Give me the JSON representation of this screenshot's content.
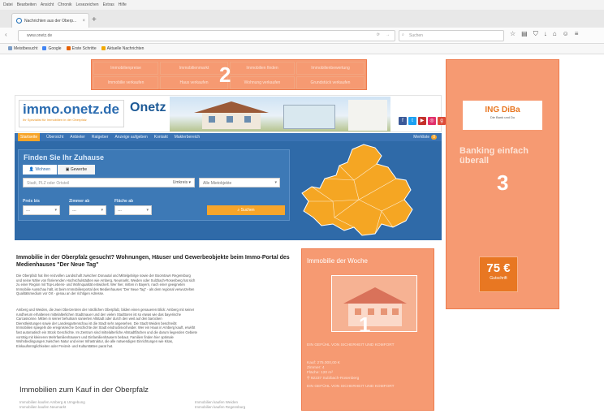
{
  "browser": {
    "menu": [
      "Datei",
      "Bearbeiten",
      "Ansicht",
      "Chronik",
      "Lesezeichen",
      "Extras",
      "Hilfe"
    ],
    "tab_title": "Nachrichten aus der Oberp...",
    "url": "www.onetz.de",
    "search_placeholder": "Suchen",
    "bookmarks": [
      "Meistbesucht",
      "Google",
      "Erste Schritte",
      "Aktuelle Nachrichten"
    ]
  },
  "top_nav": {
    "row1": [
      "Immobilienpreise",
      "Immobilienmarkt",
      "Immobilien finden",
      "Immobilienbewertung"
    ],
    "row2": [
      "Immobilie verkaufen",
      "Haus verkaufen",
      "Wohnung verkaufen",
      "Grundstück verkaufen"
    ]
  },
  "header": {
    "logo_main": "immo.onetz",
    "logo_tld": ".de",
    "logo_sub": "Ihr Spezialist für Immobilien in der Oberpfalz",
    "brand": "Onetz"
  },
  "nav": {
    "items": [
      "Startseite",
      "Übersicht",
      "Anbieter",
      "Ratgeber",
      "Anzeige aufgeben",
      "Kontakt",
      "Maklerbereich"
    ],
    "merkliste": "Merkliste",
    "merkliste_count": "0"
  },
  "search": {
    "title": "Finden Sie Ihr Zuhause",
    "tab_wohnen": "Wohnen",
    "tab_gewerbe": "Gewerbe",
    "location_placeholder": "Stadt, PLZ oder Ortsteil",
    "radius": "Umkreis",
    "category": "Alle Mietobjekte",
    "price_label": "Preis bis",
    "rooms_label": "Zimmer ab",
    "area_label": "Fläche ab",
    "empty_option": "---",
    "button": "Suchen"
  },
  "intro": {
    "title": "Immobilie in der Oberpfalz gesucht? Wohnungen, Häuser und Gewerbeobjekte beim Immo-Portal des Medienhauses \"Der Neue Tag\"",
    "p1": [
      "Die Oberpfalz hat ihre reizvollen Landschaft zwischen Donautal und Mittelgebirge sowie der Boomtown Regensburg",
      "und seine Nähe von florierenden Hochschulstädten wie Amberg, Neumarkt, Weiden oder Sulzbach-Rosenberg hat sich",
      "zu einer Region mit Top-Lebens- und Wohnqualität entwickelt. Wer hier, mitten in Bayern, nach einer geeigneten",
      "Immobilie Ausschau hält, ist beim Immobilienportal des Medienhauses \"Der Neue Tag\" - als dem regional verwurzelten",
      "Qualitätsmedium vor Ort - genau an der richtigen Adresse."
    ],
    "p2": [
      "Amberg und Weiden, die zwei Oberzentren der nördlichen Oberpfalz, bilden einen genaueren Blick: Amberg mit seiner",
      "rundherum erhaltenen mittelalterlichen Stadtmauer und den vielen Stadttoren ist so etwas wie das bayerische",
      "Carcassonne. Mitten in seiner behutsam sanierten Altstadt oder durch den weit auf den barocken",
      "Dienstleistungen sowie der Landesgartenschau ist die Stadt sehr angesehen. Die Stadt Weiden beschreibt",
      "Immobilien spiegeln die ereignisreiche Geschichte der Stadt eindrucksvoll wider. Wer ein Haus in Amberg kauft, erwirbt",
      "fast automatisch ein Stück Geschichte. Im Zentrum sind mittelalterliche Altstadtflächen und die darum liegenden Gebiete",
      "vorrätig mit kleineren Mehrfamilienhäusern und Einfamilienhäusern bebaut. Familien finden hier optimale",
      "Wohnbedingungen zwischen Natur und einer Infrastruktur, die alle notwendigen Einrichtungen wie Kitas,",
      "Einkaufsmöglichkeiten oder Freizeit- und Kulturstätten parat hat."
    ]
  },
  "section": {
    "title": "Immobilien zum Kauf in der Oberpfalz",
    "links_left": [
      "Immobilien kaufen Amberg & Umgebung",
      "Immobilien kaufen Neumarkt"
    ],
    "links_right": [
      "Immobilien kaufen Weiden",
      "Immobilien kaufen Regensburg"
    ]
  },
  "immo_week": {
    "title": "Immobilie der Woche",
    "subtitle": "EIN GEFÜHL VON SICHERHEIT UND KOMFORT",
    "price": "Kauf: 275.000,00 €",
    "rooms": "Zimmer: 4",
    "area": "Fläche: 120 m²",
    "location": "92237 Sulzbach-Rosenberg",
    "footer": "EIN GEFÜHL VON SICHERHEIT UND KOMFORT"
  },
  "ad": {
    "brand": "ING DiBa",
    "tagline": "Die Bank und Du",
    "headline_1": "Banking einfach",
    "headline_2": "überall",
    "price": "75 €",
    "price_label": "Gutschrift"
  },
  "markers": [
    "1",
    "2",
    "3"
  ],
  "colors": {
    "highlight": "#f58c5f",
    "site_blue": "#2f6aa8",
    "accent_orange": "#f7a52a"
  }
}
